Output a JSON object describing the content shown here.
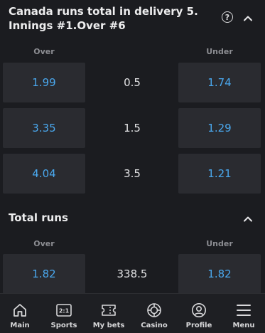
{
  "market1": {
    "title": "Canada runs total in delivery 5. Innings #1.Over #6",
    "help_glyph": "?",
    "over_label": "Over",
    "under_label": "Under",
    "rows": [
      {
        "over": "1.99",
        "line": "0.5",
        "under": "1.74"
      },
      {
        "over": "3.35",
        "line": "1.5",
        "under": "1.29"
      },
      {
        "over": "4.04",
        "line": "3.5",
        "under": "1.21"
      }
    ]
  },
  "market2": {
    "title": "Total runs",
    "over_label": "Over",
    "under_label": "Under",
    "rows": [
      {
        "over": "1.82",
        "line": "338.5",
        "under": "1.82"
      }
    ]
  },
  "nav": {
    "items": [
      {
        "label": "Main",
        "icon": "home-icon"
      },
      {
        "label": "Sports",
        "icon": "scoreboard-icon"
      },
      {
        "label": "My bets",
        "icon": "ticket-icon"
      },
      {
        "label": "Casino",
        "icon": "casino-chip-icon"
      },
      {
        "label": "Profile",
        "icon": "profile-icon"
      },
      {
        "label": "Menu",
        "icon": "menu-icon"
      }
    ],
    "sports_icon_text": "2:1"
  },
  "colors": {
    "background": "#1b1c20",
    "cell": "#2a2b30",
    "odds_text": "#4aa8ee"
  }
}
